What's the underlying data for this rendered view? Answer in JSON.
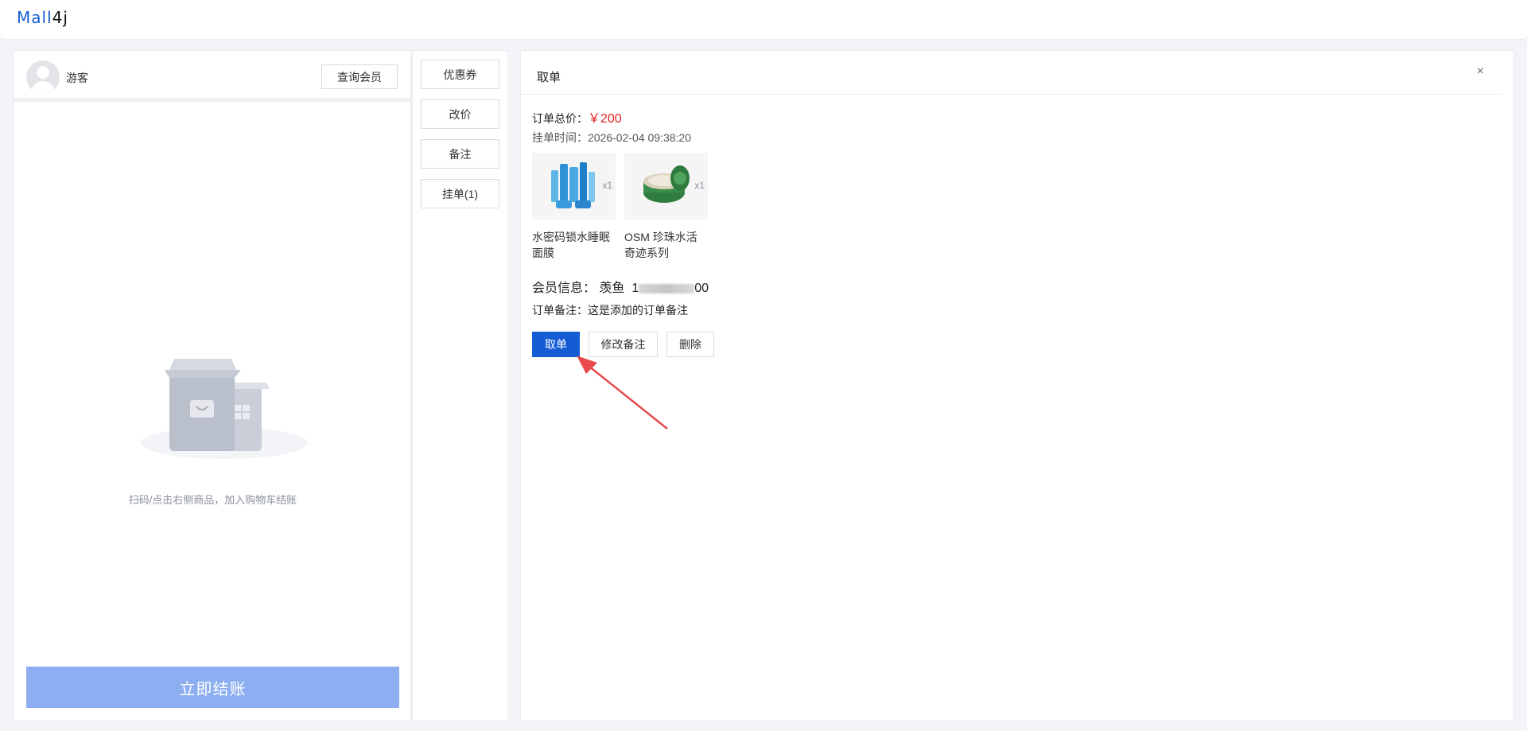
{
  "logo": {
    "part1": "Mall",
    "part2": "4j"
  },
  "member": {
    "name": "游客",
    "query_button": "查询会员"
  },
  "cart": {
    "empty_text": "扫码/点击右侧商品，加入购物车结账",
    "checkout_button": "立即结账"
  },
  "actions": {
    "coupon": "优惠券",
    "change_price": "改价",
    "remark": "备注",
    "hang_order": "挂单(1)"
  },
  "take_order": {
    "title": "取单",
    "close": "×",
    "total_label": "订单总价：",
    "total_value": "￥200",
    "time_label": "挂单时间：",
    "time_value": "2026-02-04 09:38:20",
    "products": [
      {
        "name": "水密码锁水睡眠面膜",
        "qty": "x1"
      },
      {
        "name": "OSM 珍珠水活奇迹系列",
        "qty": "x1"
      }
    ],
    "member_label": "会员信息：",
    "member_name": "羡鱼",
    "member_phone_start": "1",
    "member_phone_end": "00",
    "note_label": "订单备注：",
    "note_value": "这是添加的订单备注",
    "take_button": "取单",
    "edit_note_button": "修改备注",
    "delete_button": "删除"
  },
  "colors": {
    "primary": "#155bd4",
    "price_red": "#e02020",
    "checkout_disabled": "#8daef0",
    "annotation_arrow": "#e84b4b"
  }
}
